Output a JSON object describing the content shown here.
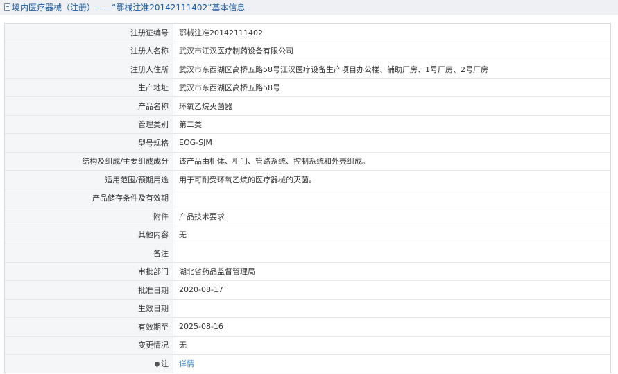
{
  "header": {
    "icon": "document-icon",
    "title": "境内医疗器械（注册）——“鄂械注准20142111402”基本信息"
  },
  "rows": [
    {
      "label": "注册证编号",
      "value": "鄂械注准20142111402"
    },
    {
      "label": "注册人名称",
      "value": "武汉市江汉医疗制药设备有限公司"
    },
    {
      "label": "注册人住所",
      "value": "武汉市东西湖区高桥五路58号江汉医疗设备生产项目办公楼、辅助厂房、1号厂房、2号厂房"
    },
    {
      "label": "生产地址",
      "value": "武汉市东西湖区高桥五路58号"
    },
    {
      "label": "产品名称",
      "value": "环氧乙烷灭菌器"
    },
    {
      "label": "管理类别",
      "value": "第二类"
    },
    {
      "label": "型号规格",
      "value": "EOG-SJM"
    },
    {
      "label": "结构及组成/主要组成成分",
      "value": "该产品由柜体、柜门、管路系统、控制系统和外壳组成。"
    },
    {
      "label": "适用范围/预期用途",
      "value": "用于可耐受环氧乙烷的医疗器械的灭菌。"
    },
    {
      "label": "产品储存条件及有效期",
      "value": ""
    },
    {
      "label": "附件",
      "value": "产品技术要求"
    },
    {
      "label": "其他内容",
      "value": "无"
    },
    {
      "label": "备注",
      "value": ""
    },
    {
      "label": "审批部门",
      "value": "湖北省药品监督管理局"
    },
    {
      "label": "批准日期",
      "value": "2020-08-17"
    },
    {
      "label": "生效日期",
      "value": ""
    },
    {
      "label": "有效期至",
      "value": "2025-08-16"
    },
    {
      "label": "变更情况",
      "value": "无"
    }
  ],
  "note_row": {
    "icon": "pin-icon",
    "label": "注",
    "link_text": "详情"
  },
  "colors": {
    "title_text": "#1a5a9e",
    "link": "#2a7bd0",
    "label_bg": "#f5f6f8"
  }
}
